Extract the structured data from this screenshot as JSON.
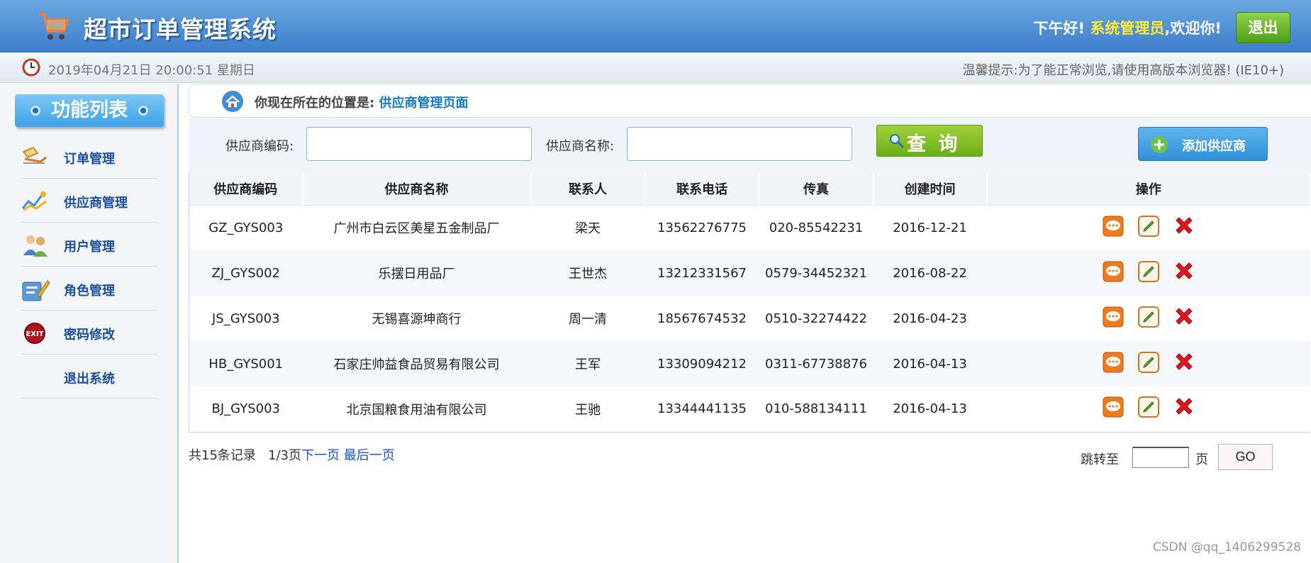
{
  "header": {
    "title": "超市订单管理系统",
    "greeting": "下午好!",
    "user": "系统管理员",
    "welcome": ",欢迎你!",
    "logout": "退出"
  },
  "subbar": {
    "datetime": "2019年04月21日 20:00:51 星期日",
    "tip": "温馨提示:为了能正常浏览,请使用高版本浏览器! (IE10+)"
  },
  "sidebar": {
    "title": "功能列表",
    "items": [
      {
        "label": "订单管理",
        "icon": "order-icon"
      },
      {
        "label": "供应商管理",
        "icon": "provider-icon"
      },
      {
        "label": "用户管理",
        "icon": "users-icon"
      },
      {
        "label": "角色管理",
        "icon": "role-icon"
      },
      {
        "label": "密码修改",
        "icon": "exit-badge-icon"
      },
      {
        "label": "退出系统",
        "icon": ""
      }
    ]
  },
  "breadcrumb": {
    "prefix": "你现在所在的位置是:",
    "page": "供应商管理页面"
  },
  "search": {
    "code_label": "供应商编码:",
    "code_value": "",
    "name_label": "供应商名称:",
    "name_value": "",
    "query_button": "查 询",
    "add_button": "添加供应商"
  },
  "table": {
    "headers": [
      "供应商编码",
      "供应商名称",
      "联系人",
      "联系电话",
      "传真",
      "创建时间",
      "操作"
    ],
    "rows": [
      [
        "GZ_GYS003",
        "广州市白云区美星五金制品厂",
        "梁天",
        "13562276775",
        "020-85542231",
        "2016-12-21"
      ],
      [
        "ZJ_GYS002",
        "乐摆日用品厂",
        "王世杰",
        "13212331567",
        "0579-34452321",
        "2016-08-22"
      ],
      [
        "JS_GYS003",
        "无锡喜源坤商行",
        "周一清",
        "18567674532",
        "0510-32274422",
        "2016-04-23"
      ],
      [
        "HB_GYS001",
        "石家庄帅益食品贸易有限公司",
        "王军",
        "13309094212",
        "0311-67738876",
        "2016-04-13"
      ],
      [
        "BJ_GYS003",
        "北京国粮食用油有限公司",
        "王驰",
        "13344441135",
        "010-588134111",
        "2016-04-13"
      ]
    ]
  },
  "pager": {
    "total": "共15条记录",
    "page": "1/3页",
    "next": "下一页",
    "last": "最后一页",
    "jump_label": "跳转至",
    "jump_value": "",
    "page_unit": "页",
    "go": "GO"
  },
  "watermark": "CSDN @qq_1406299528",
  "colors": {
    "header": "#4a8fd6",
    "accent_green": "#7fc024",
    "accent_blue": "#3a9be0",
    "link": "#1a4fa0"
  }
}
